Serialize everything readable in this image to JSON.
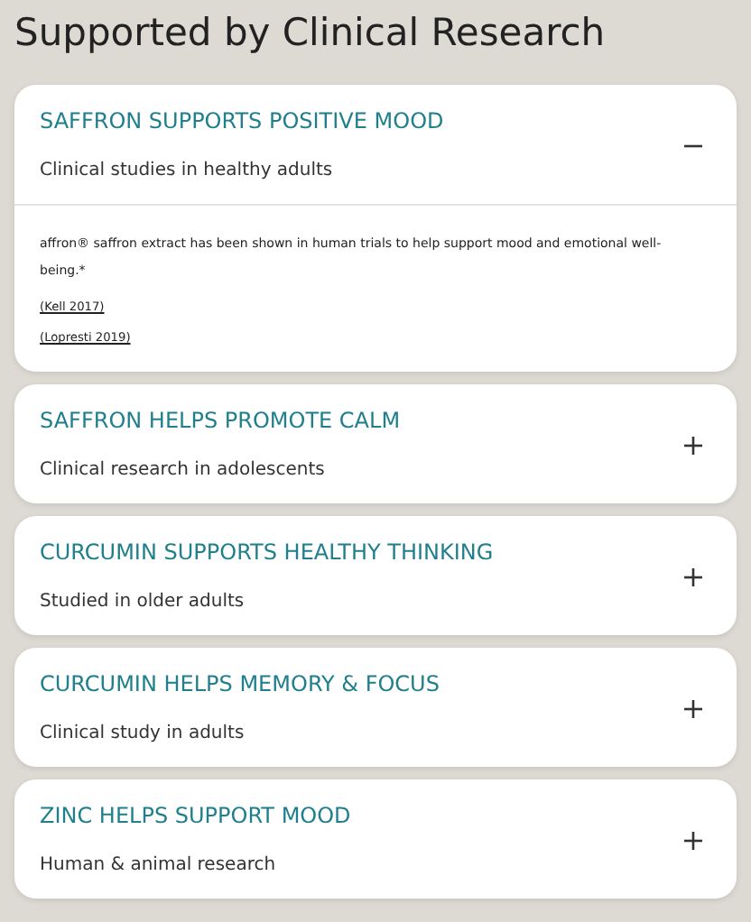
{
  "heading": "Supported by Clinical Research",
  "items": [
    {
      "title": "SAFFRON SUPPORTS POSITIVE MOOD",
      "subtitle": "Clinical studies in healthy adults",
      "expanded": true,
      "body": "affron® saffron extract has been shown in human trials to help support mood and emotional well-being.*",
      "links": [
        "(Kell 2017)",
        "(Lopresti 2019)"
      ]
    },
    {
      "title": "SAFFRON HELPS PROMOTE CALM",
      "subtitle": "Clinical research in adolescents",
      "expanded": false
    },
    {
      "title": "CURCUMIN SUPPORTS HEALTHY THINKING",
      "subtitle": "Studied in older adults",
      "expanded": false
    },
    {
      "title": "CURCUMIN HELPS MEMORY & FOCUS",
      "subtitle": "Clinical study in adults",
      "expanded": false
    },
    {
      "title": "ZINC HELPS SUPPORT MOOD",
      "subtitle": "Human & animal research",
      "expanded": false
    }
  ]
}
